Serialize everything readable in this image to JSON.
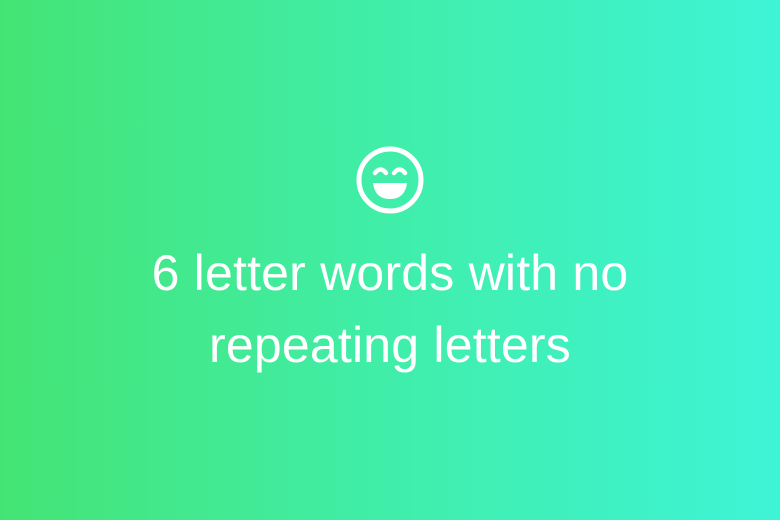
{
  "banner": {
    "icon": "smiling-face-with-smiling-eyes-icon",
    "headline_line1": "6 letter words with no",
    "headline_line2": "repeating letters"
  },
  "colors": {
    "gradient_start": "#44e474",
    "gradient_end": "#3ef4d6",
    "text": "#ffffff"
  }
}
